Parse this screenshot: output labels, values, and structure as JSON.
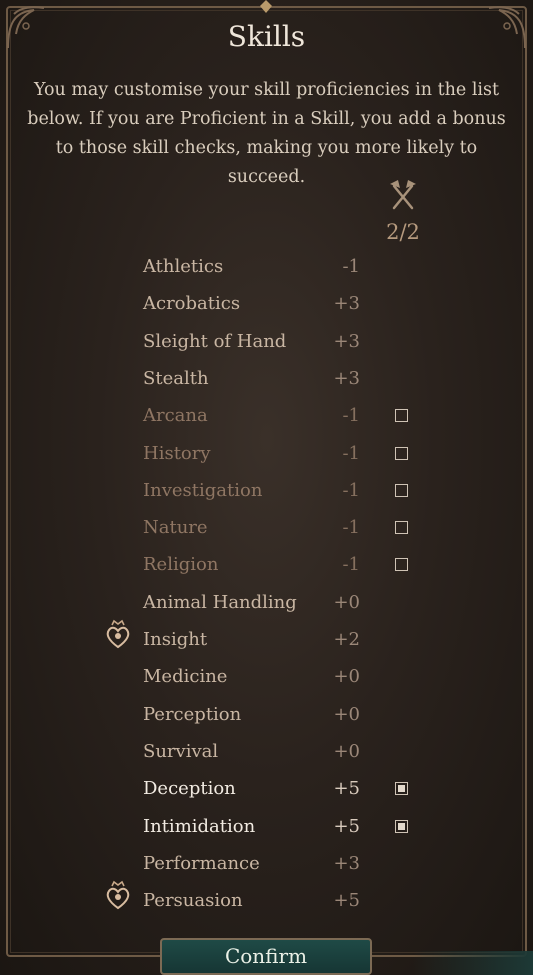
{
  "header": {
    "title": "Skills",
    "description": "You may customise your skill proficiencies in the list below. If you are Proficient in a Skill, you add a bonus to those skill checks, making you more likely to succeed."
  },
  "proficiency_counter": {
    "icon": "crossed-axes-icon",
    "text": "2/2"
  },
  "skills": [
    {
      "name": "Athletics",
      "modifier": "-1",
      "state": "normal",
      "checkbox": "none"
    },
    {
      "name": "Acrobatics",
      "modifier": "+3",
      "state": "normal",
      "checkbox": "none"
    },
    {
      "name": "Sleight of Hand",
      "modifier": "+3",
      "state": "normal",
      "checkbox": "none"
    },
    {
      "name": "Stealth",
      "modifier": "+3",
      "state": "normal",
      "checkbox": "none"
    },
    {
      "name": "Arcana",
      "modifier": "-1",
      "state": "dim",
      "checkbox": "empty"
    },
    {
      "name": "History",
      "modifier": "-1",
      "state": "dim",
      "checkbox": "empty"
    },
    {
      "name": "Investigation",
      "modifier": "-1",
      "state": "dim",
      "checkbox": "empty"
    },
    {
      "name": "Nature",
      "modifier": "-1",
      "state": "dim",
      "checkbox": "empty"
    },
    {
      "name": "Religion",
      "modifier": "-1",
      "state": "dim",
      "checkbox": "empty"
    },
    {
      "name": "Animal Handling",
      "modifier": "+0",
      "state": "normal",
      "checkbox": "none"
    },
    {
      "name": "Insight",
      "modifier": "+2",
      "state": "normal",
      "checkbox": "none",
      "badge": "proficiency-heart-icon"
    },
    {
      "name": "Medicine",
      "modifier": "+0",
      "state": "normal",
      "checkbox": "none"
    },
    {
      "name": "Perception",
      "modifier": "+0",
      "state": "normal",
      "checkbox": "none"
    },
    {
      "name": "Survival",
      "modifier": "+0",
      "state": "normal",
      "checkbox": "none"
    },
    {
      "name": "Deception",
      "modifier": "+5",
      "state": "bright",
      "checkbox": "checked"
    },
    {
      "name": "Intimidation",
      "modifier": "+5",
      "state": "bright",
      "checkbox": "checked"
    },
    {
      "name": "Performance",
      "modifier": "+3",
      "state": "normal",
      "checkbox": "none"
    },
    {
      "name": "Persuasion",
      "modifier": "+5",
      "state": "normal",
      "checkbox": "none",
      "badge": "proficiency-heart-icon"
    }
  ],
  "confirm_label": "Confirm",
  "colors": {
    "background": "#2a221d",
    "frame": "#6e5a45",
    "confirm_bg": "#1f4a46"
  }
}
